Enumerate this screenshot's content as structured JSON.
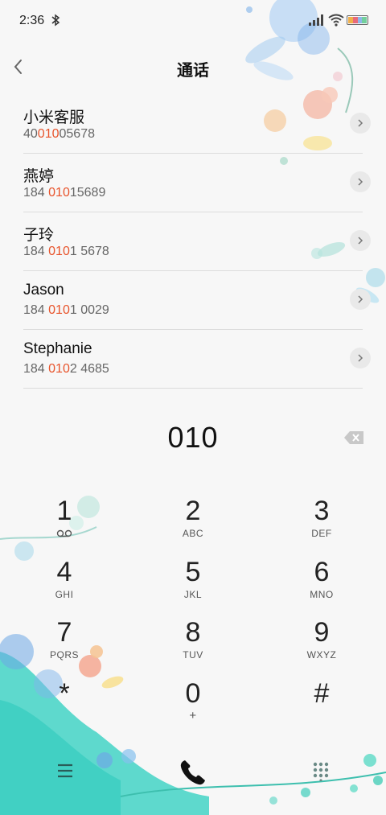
{
  "status_bar": {
    "time": "2:36"
  },
  "header": {
    "title": "通话"
  },
  "contacts": [
    {
      "name": "小米客服",
      "num_pre": "40",
      "num_hl": "010",
      "num_post": "05678"
    },
    {
      "name": "燕婷",
      "num_pre": "184 ",
      "num_hl": "010",
      "num_post": "15689"
    },
    {
      "name": "子玲",
      "num_pre": "184 ",
      "num_hl": "010",
      "num_post": "1 5678"
    },
    {
      "name": "Jason",
      "num_pre": "184 ",
      "num_hl": "010",
      "num_post": "1 0029"
    },
    {
      "name": "Stephanie",
      "num_pre": "184 ",
      "num_hl": "010",
      "num_post": "2 4685"
    }
  ],
  "dial": {
    "digits": "010"
  },
  "keypad": [
    {
      "digit": "1",
      "letters": ""
    },
    {
      "digit": "2",
      "letters": "ABC"
    },
    {
      "digit": "3",
      "letters": "DEF"
    },
    {
      "digit": "4",
      "letters": "GHI"
    },
    {
      "digit": "5",
      "letters": "JKL"
    },
    {
      "digit": "6",
      "letters": "MNO"
    },
    {
      "digit": "7",
      "letters": "PQRS"
    },
    {
      "digit": "8",
      "letters": "TUV"
    },
    {
      "digit": "9",
      "letters": "WXYZ"
    },
    {
      "digit": "*",
      "letters": ""
    },
    {
      "digit": "0",
      "letters": "+"
    },
    {
      "digit": "#",
      "letters": ""
    }
  ],
  "colors": {
    "accent_highlight": "#e8542c",
    "background": "#f7f7f7",
    "flower_teal": "#3fd6c4",
    "flower_blue": "#8fc0ee"
  }
}
